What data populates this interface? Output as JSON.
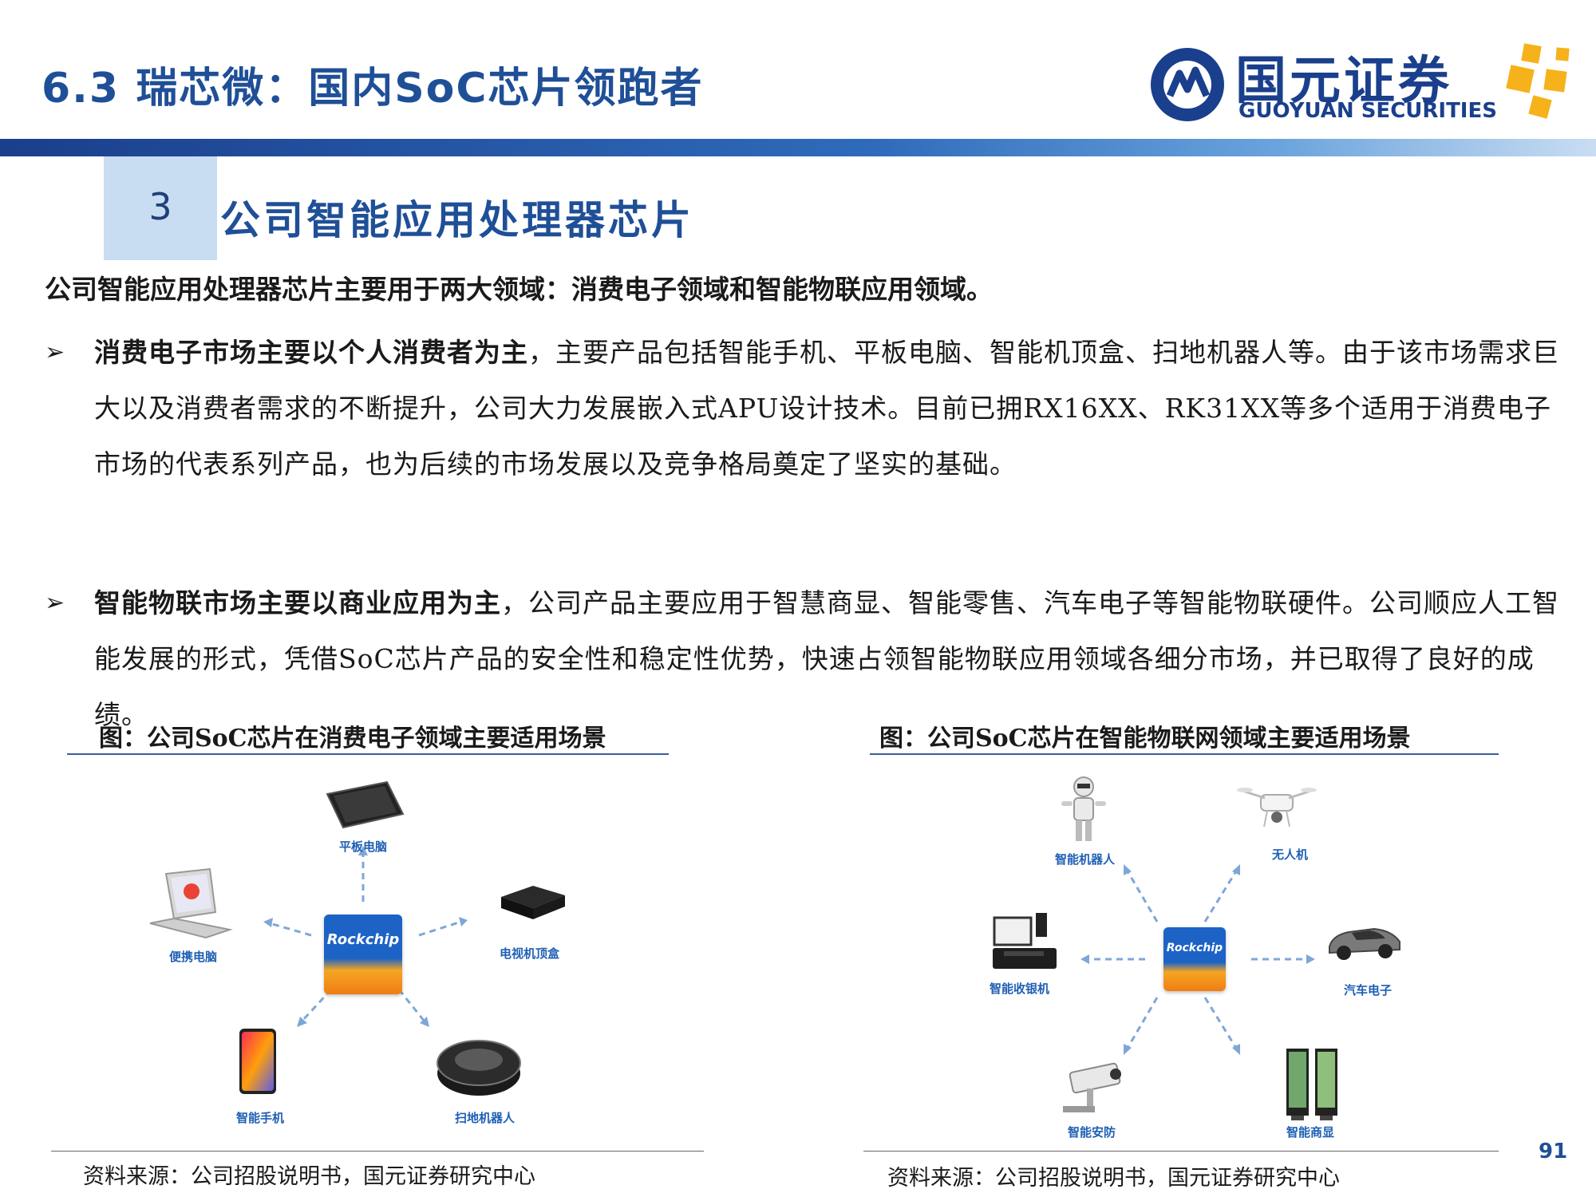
{
  "header": {
    "title": "6.3 瑞芯微：国内SoC芯片领跑者",
    "logo_cn": "国元证券",
    "logo_en": "GUOYUAN SECURITIES"
  },
  "section": {
    "number": "3",
    "title": "公司智能应用处理器芯片"
  },
  "lead": "公司智能应用处理器芯片主要用于两大领域：消费电子领域和智能物联应用领域。",
  "bullets": [
    {
      "marker": "➢",
      "bold": "消费电子市场主要以个人消费者为主",
      "text": "，主要产品包括智能手机、平板电脑、智能机顶盒、扫地机器人等。由于该市场需求巨大以及消费者需求的不断提升，公司大力发展嵌入式APU设计技术。目前已拥RX16XX、RK31XX等多个适用于消费电子市场的代表系列产品，也为后续的市场发展以及竞争格局奠定了坚实的基础。"
    },
    {
      "marker": "➢",
      "bold": "智能物联市场主要以商业应用为主",
      "text": "，公司产品主要应用于智慧商显、智能零售、汽车电子等智能物联硬件。公司顺应人工智能发展的形式，凭借SoC芯片产品的安全性和稳定性优势，快速占领智能物联应用领域各细分市场，并已取得了良好的成绩。"
    }
  ],
  "figure_left": {
    "caption": "图：公司SoC芯片在消费电子领域主要适用场景",
    "chip_label": "Rockchip",
    "labels": {
      "tablet": "平板电脑",
      "laptop": "便携电脑",
      "tvbox": "电视机顶盒",
      "phone": "智能手机",
      "robot_vacuum": "扫地机器人"
    },
    "source": "资料来源：公司招股说明书，国元证券研究中心"
  },
  "figure_right": {
    "caption": "图：公司SoC芯片在智能物联网领域主要适用场景",
    "chip_label": "Rockchip",
    "labels": {
      "robot": "智能机器人",
      "drone": "无人机",
      "pos": "智能收银机",
      "car": "汽车电子",
      "camera": "智能安防",
      "display": "智能商显"
    },
    "source": "资料来源：公司招股说明书，国元证券研究中心"
  },
  "page_number": "91",
  "colors": {
    "brand_blue": "#1f4f97",
    "logo_yellow": "#f5b21a",
    "chip_blue": "#1d63c6",
    "chip_orange": "#f07c14"
  }
}
